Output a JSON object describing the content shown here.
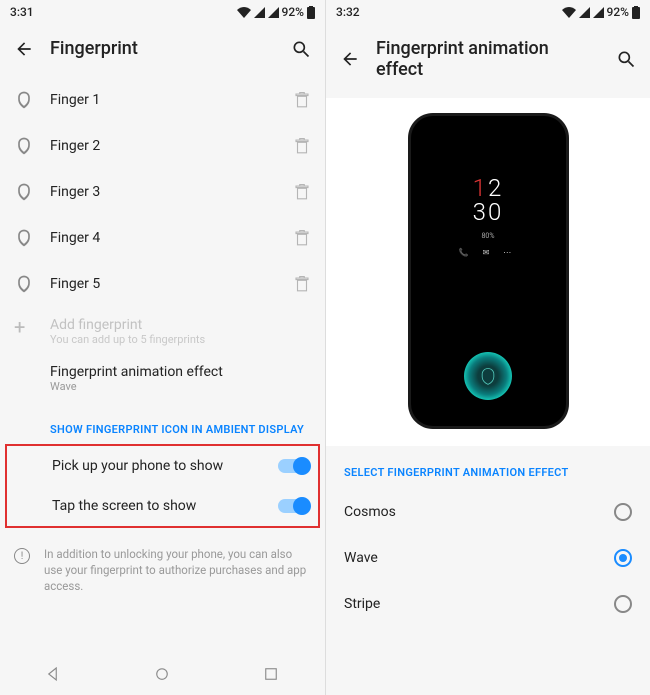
{
  "left": {
    "status": {
      "time": "3:31",
      "battery": "92%"
    },
    "title": "Fingerprint",
    "fingers": [
      "Finger 1",
      "Finger 2",
      "Finger 3",
      "Finger 4",
      "Finger 5"
    ],
    "add": {
      "title": "Add fingerprint",
      "sub": "You can add up to 5 fingerprints"
    },
    "anim": {
      "title": "Fingerprint animation effect",
      "value": "Wave"
    },
    "section": "SHOW FINGERPRINT ICON IN AMBIENT DISPLAY",
    "toggles": [
      {
        "label": "Pick up your phone to show"
      },
      {
        "label": "Tap the screen to show"
      }
    ],
    "info": "In addition to unlocking your phone, you can also use your fingerprint to authorize purchases and app access."
  },
  "right": {
    "status": {
      "time": "3:32",
      "battery": "92%"
    },
    "title": "Fingerprint animation effect",
    "preview": {
      "hh": "12",
      "mm": "30",
      "batt": "80%"
    },
    "section": "SELECT FINGERPRINT ANIMATION EFFECT",
    "options": [
      {
        "label": "Cosmos",
        "selected": false
      },
      {
        "label": "Wave",
        "selected": true
      },
      {
        "label": "Stripe",
        "selected": false
      }
    ]
  }
}
